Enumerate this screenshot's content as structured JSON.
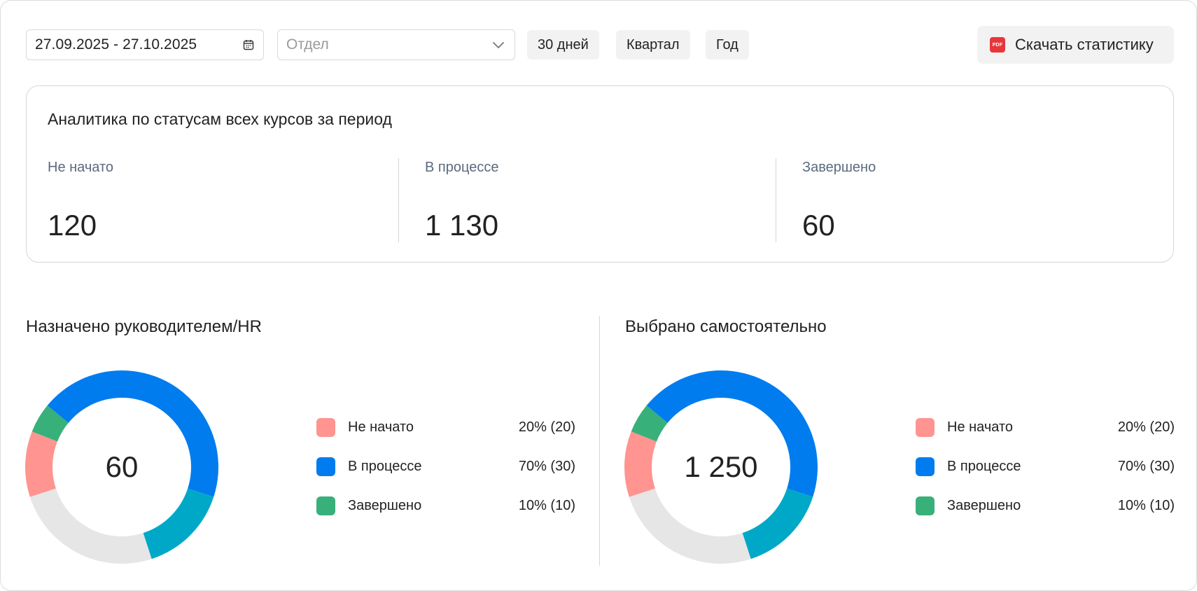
{
  "toolbar": {
    "date_range": "27.09.2025 - 27.10.2025",
    "department_placeholder": "Отдел",
    "period_buttons": [
      "30 дней",
      "Квартал",
      "Год"
    ],
    "download_icon_text": "PDF",
    "download_label": "Скачать статистику"
  },
  "summary": {
    "title": "Аналитика по статусам всех курсов за период",
    "stats": [
      {
        "label": "Не начато",
        "value": "120"
      },
      {
        "label": "В процессе",
        "value": "1 130"
      },
      {
        "label": "Завершено",
        "value": "60"
      }
    ]
  },
  "colors": {
    "not_started": "#ff9490",
    "in_progress": "#007cef",
    "completed": "#38b07a",
    "teal": "#00a8c8",
    "remainder": "#e6e6e6"
  },
  "panels": [
    {
      "title": "Назначено руководителем/HR",
      "center_value": "60",
      "legend": [
        {
          "name": "Не начато",
          "value": "20% (20)",
          "color": "#ff9490"
        },
        {
          "name": "В процессе",
          "value": "70% (30)",
          "color": "#007cef"
        },
        {
          "name": "Завершено",
          "value": "10% (10)",
          "color": "#38b07a"
        }
      ]
    },
    {
      "title": "Выбрано самостоятельно",
      "center_value": "1 250",
      "legend": [
        {
          "name": "Не начато",
          "value": "20% (20)",
          "color": "#ff9490"
        },
        {
          "name": "В процессе",
          "value": "70% (30)",
          "color": "#007cef"
        },
        {
          "name": "Завершено",
          "value": "10% (10)",
          "color": "#38b07a"
        }
      ]
    }
  ],
  "chart_data": [
    {
      "type": "pie",
      "center_label": "60",
      "slices": [
        {
          "name": "В процессе",
          "value": 30,
          "color": "#007cef"
        },
        {
          "name": "",
          "value": 15,
          "color": "#00a8c8"
        },
        {
          "name": "",
          "value": 25,
          "color": "#e6e6e6"
        },
        {
          "name": "Не начато",
          "value": 11,
          "color": "#ff9490"
        },
        {
          "name": "Завершено",
          "value": 5,
          "color": "#38b07a"
        },
        {
          "name": "В процессе",
          "value": 14,
          "color": "#007cef"
        }
      ]
    },
    {
      "type": "pie",
      "center_label": "1 250",
      "slices": [
        {
          "name": "В процессе",
          "value": 30,
          "color": "#007cef"
        },
        {
          "name": "",
          "value": 15,
          "color": "#00a8c8"
        },
        {
          "name": "",
          "value": 25,
          "color": "#e6e6e6"
        },
        {
          "name": "Не начато",
          "value": 11,
          "color": "#ff9490"
        },
        {
          "name": "Завершено",
          "value": 5,
          "color": "#38b07a"
        },
        {
          "name": "В процессе",
          "value": 14,
          "color": "#007cef"
        }
      ]
    }
  ]
}
